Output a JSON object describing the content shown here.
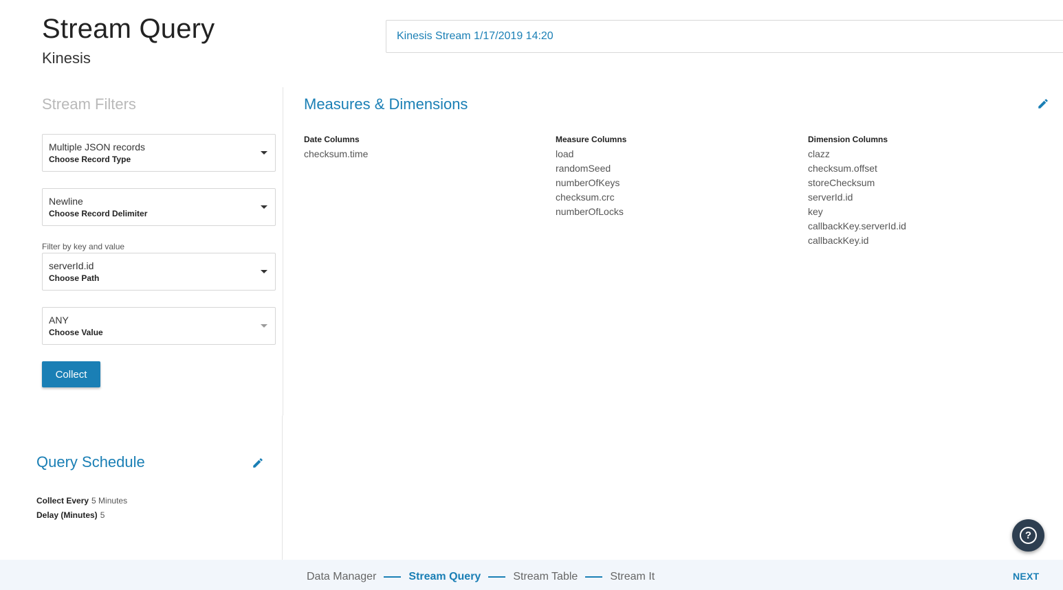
{
  "header": {
    "title": "Stream Query",
    "subtitle": "Kinesis",
    "stream_name": "Kinesis Stream 1/17/2019 14:20"
  },
  "filters": {
    "title": "Stream Filters",
    "record_type": {
      "value": "Multiple JSON records",
      "label": "Choose Record Type"
    },
    "record_delimiter": {
      "value": "Newline",
      "label": "Choose Record Delimiter"
    },
    "filter_caption": "Filter by key and value",
    "path": {
      "value": "serverId.id",
      "label": "Choose Path"
    },
    "value": {
      "value": "ANY",
      "label": "Choose Value"
    },
    "collect_label": "Collect"
  },
  "schedule": {
    "title": "Query Schedule",
    "collect_every_label": "Collect Every",
    "collect_every_value": "5 Minutes",
    "delay_label": "Delay (Minutes)",
    "delay_value": "5"
  },
  "measures": {
    "title": "Measures & Dimensions",
    "date_columns": {
      "header": "Date Columns",
      "items": [
        "checksum.time"
      ]
    },
    "measure_columns": {
      "header": "Measure Columns",
      "items": [
        "load",
        "randomSeed",
        "numberOfKeys",
        "checksum.crc",
        "numberOfLocks"
      ]
    },
    "dimension_columns": {
      "header": "Dimension Columns",
      "items": [
        "clazz",
        "checksum.offset",
        "storeChecksum",
        "serverId.id",
        "key",
        "callbackKey.serverId.id",
        "callbackKey.id"
      ]
    }
  },
  "footer": {
    "steps": [
      "Data Manager",
      "Stream Query",
      "Stream Table",
      "Stream It"
    ],
    "next_label": "NEXT"
  },
  "help": {
    "glyph": "?"
  },
  "colors": {
    "accent": "#1a7fb5",
    "muted_title": "#b9b9b9",
    "footer_bg": "#f2f6fb",
    "help_bg": "#2d3e50"
  }
}
